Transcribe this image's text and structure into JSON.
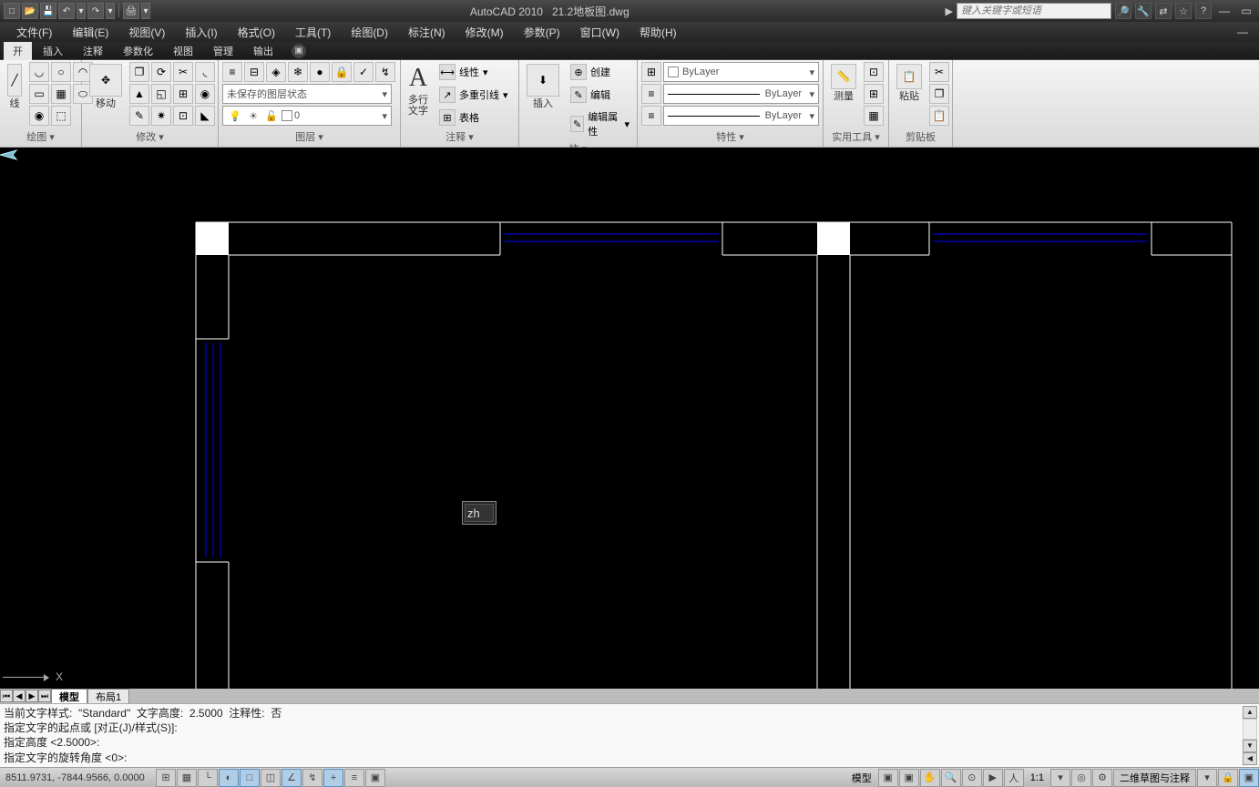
{
  "title": {
    "app": "AutoCAD 2010",
    "file": "21.2地板图.dwg"
  },
  "search": {
    "placeholder": "键入关键字或短语"
  },
  "menus": [
    "文件(F)",
    "编辑(E)",
    "视图(V)",
    "插入(I)",
    "格式(O)",
    "工具(T)",
    "绘图(D)",
    "标注(N)",
    "修改(M)",
    "参数(P)",
    "窗口(W)",
    "帮助(H)"
  ],
  "ribbonTabs": [
    "开",
    "插入",
    "注释",
    "参数化",
    "视图",
    "管理",
    "输出"
  ],
  "ribbon": {
    "draw": {
      "title": "绘图 ▾",
      "sideLabel": "线"
    },
    "modify": {
      "title": "修改 ▾",
      "moveLabel": "移动"
    },
    "layers": {
      "title": "图层 ▾",
      "stateCombo": "未保存的图层状态",
      "layerCombo": "0"
    },
    "annot": {
      "title": "注释 ▾",
      "mtextLabel": "多行\n文字",
      "linear": "线性",
      "mleader": "多重引线",
      "table": "表格"
    },
    "block": {
      "title": "块 ▾",
      "insertLabel": "插入",
      "create": "创建",
      "edit": "编辑",
      "editAttr": "编辑属性"
    },
    "props": {
      "title": "特性 ▾",
      "bylayer": "ByLayer"
    },
    "utilities": {
      "title": "实用工具 ▾",
      "measure": "测量"
    },
    "clipboard": {
      "title": "剪贴板",
      "paste": "粘贴"
    }
  },
  "modelTabs": {
    "model": "模型",
    "layout1": "布局1"
  },
  "commandText": "当前文字样式:  \"Standard\"  文字高度:  2.5000  注释性:  否\n指定文字的起点或 [对正(J)/样式(S)]:\n指定高度 <2.5000>:\n指定文字的旋转角度 <0>:",
  "cursor": {
    "input": "zh"
  },
  "status": {
    "coords": "8511.9731, -7844.9566, 0.0000",
    "rightModel": "模型",
    "scale": "1:1",
    "workspace": "二维草图与注释"
  }
}
